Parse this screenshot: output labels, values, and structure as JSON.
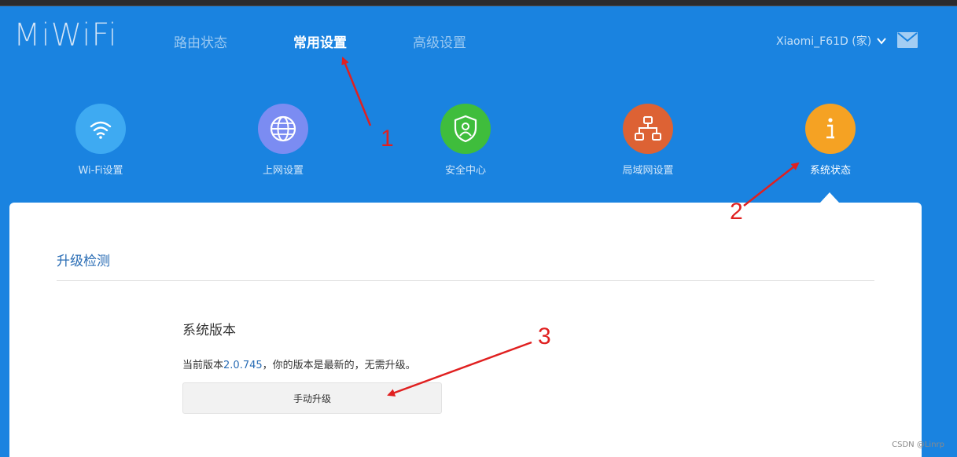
{
  "header": {
    "logo": "MiWiFi",
    "nav": [
      {
        "label": "路由状态",
        "active": false
      },
      {
        "label": "常用设置",
        "active": true
      },
      {
        "label": "高级设置",
        "active": false
      }
    ],
    "account": "Xiaomi_F61D (家)"
  },
  "quick_items": [
    {
      "label": "Wi-Fi设置",
      "icon": "wifi-icon",
      "color": "#3eaaf2"
    },
    {
      "label": "上网设置",
      "icon": "globe-icon",
      "color": "#7b8cf2"
    },
    {
      "label": "安全中心",
      "icon": "shield-icon",
      "color": "#3fbd3c"
    },
    {
      "label": "局域网设置",
      "icon": "network-icon",
      "color": "#dd6234"
    },
    {
      "label": "系统状态",
      "icon": "info-icon",
      "color": "#f5a223",
      "active": true
    }
  ],
  "panel": {
    "section_title": "升级检测",
    "version_title": "系统版本",
    "version_prefix": "当前版本",
    "version": "2.0.745",
    "version_suffix": "，你的版本是最新的，无需升级。",
    "upgrade_button": "手动升级"
  },
  "annotations": [
    "1",
    "2",
    "3"
  ],
  "watermark": "CSDN @Linrp",
  "colors": {
    "background": "#1a83e0",
    "panel": "#ffffff",
    "link": "#2a6db5",
    "annotation": "#e02020"
  }
}
